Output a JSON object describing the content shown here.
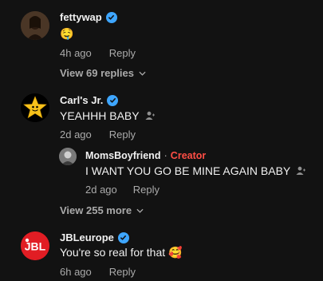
{
  "colors": {
    "background": "#121212",
    "text": "#f1f1f1",
    "muted": "#aaaaaa",
    "verified": "#3ea6ff",
    "creator": "#ff4e45",
    "jbl": "#e11d24"
  },
  "comments": [
    {
      "username": "fettywap",
      "verified": true,
      "text": "🤤",
      "time": "4h ago",
      "reply_label": "Reply",
      "view_replies": "View 69 replies"
    },
    {
      "username": "Carl's Jr.",
      "verified": true,
      "text": "YEAHHH BABY",
      "time": "2d ago",
      "reply_label": "Reply",
      "reply": {
        "username": "MomsBoyfriend",
        "separator": "·",
        "tag": "Creator",
        "text": "I WANT YOU GO BE MINE AGAIN BABY",
        "time": "2d ago",
        "reply_label": "Reply"
      },
      "view_replies": "View 255 more"
    },
    {
      "username": "JBLeurope",
      "verified": true,
      "avatar_text": "JBL",
      "text": "You're so real for that 🥰",
      "time": "6h ago",
      "reply_label": "Reply"
    }
  ]
}
